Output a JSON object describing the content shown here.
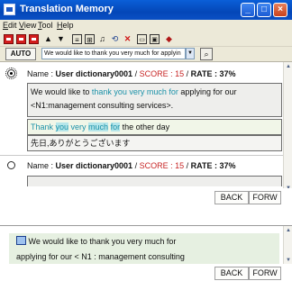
{
  "window": {
    "title": "Translation Memory",
    "min": "_",
    "max": "□",
    "close": "×"
  },
  "menu": [
    {
      "label": "Edit",
      "accel": "E",
      "rest": "dit"
    },
    {
      "label": "View",
      "accel": "V",
      "rest": "iew"
    },
    {
      "label": "Tool",
      "accel": "T",
      "rest": "ool"
    },
    {
      "label": "Help",
      "accel": "H",
      "rest": "elp"
    }
  ],
  "toolbar": {
    "icons": [
      "red-doc-icon",
      "red-doc-icon",
      "red-doc-icon",
      "up-arrow-icon",
      "down-arrow-icon",
      "table-icon",
      "table-icon",
      "music-icon",
      "link-icon",
      "delete-icon",
      "frame-icon",
      "frame-icon",
      "diamond-icon"
    ]
  },
  "autobar": {
    "auto_label": "AUTO",
    "source_text": "We would like to thank you very much for applyin",
    "search_icon": "search-icon"
  },
  "entries": [
    {
      "name_label": "Name : ",
      "dictionary": "User dictionary0001",
      "sep": " / ",
      "score_label": "SCORE : 15",
      "rate_label": "RATE : 37%",
      "src_a": "We would like to ",
      "src_b": "thank you very much for",
      "src_c": " applying for our",
      "src_d": "<N1:management consulting services>.",
      "tgt_a": "Thank ",
      "tgt_b": "you",
      "tgt_c": " very ",
      "tgt_d": "much",
      "tgt_e": " ",
      "tgt_f": "for",
      "tgt_g": " the other day",
      "tgt_jp": "先日,ありがとうございます"
    },
    {
      "name_label": "Name : ",
      "dictionary": "User dictionary0001",
      "sep": " / ",
      "score_label": "SCORE : 15",
      "rate_label": "RATE : 37%"
    }
  ],
  "nav": {
    "back": "BACK",
    "forward": "FORW"
  },
  "preview": {
    "line1": "We would like to thank you very much for",
    "line2": "applying for our < N1 : management consulting",
    "line3": "services >"
  }
}
